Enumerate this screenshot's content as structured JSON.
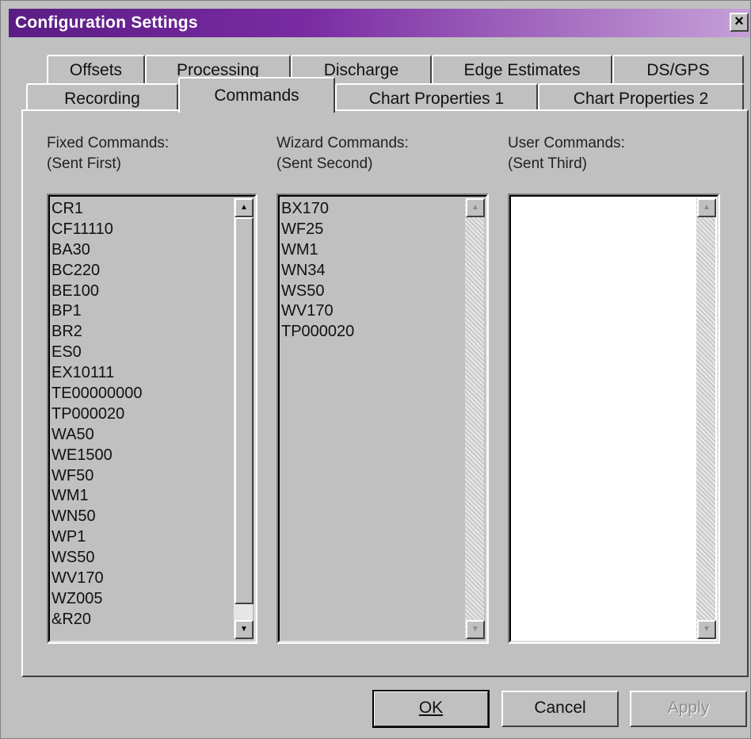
{
  "window": {
    "title": "Configuration Settings",
    "close_label": "×"
  },
  "tabs_back": [
    "Offsets",
    "Processing",
    "Discharge",
    "Edge Estimates",
    "DS/GPS"
  ],
  "tabs_front": [
    "Recording",
    "Commands",
    "Chart Properties 1",
    "Chart Properties 2"
  ],
  "active_tab": "Commands",
  "fixed": {
    "line1": "Fixed Commands:",
    "line2": "(Sent First)",
    "items": [
      "CR1",
      "CF11110",
      "BA30",
      "BC220",
      "BE100",
      "BP1",
      "BR2",
      "ES0",
      "EX10111",
      "TE00000000",
      "TP000020",
      "WA50",
      "WE1500",
      "WF50",
      "WM1",
      "WN50",
      "WP1",
      "WS50",
      "WV170",
      "WZ005",
      "&R20"
    ]
  },
  "wizard": {
    "line1": "Wizard Commands:",
    "line2": "(Sent Second)",
    "items": [
      "BX170",
      "WF25",
      "WM1",
      "WN34",
      "WS50",
      "WV170",
      "TP000020"
    ]
  },
  "user": {
    "line1": "User Commands:",
    "line2": "(Sent Third)",
    "items": []
  },
  "buttons": {
    "ok": "OK",
    "cancel": "Cancel",
    "apply": "Apply"
  },
  "icons": {
    "scroll_up": "scroll-up-arrow-icon",
    "scroll_down": "scroll-down-arrow-icon",
    "close": "close-icon"
  }
}
